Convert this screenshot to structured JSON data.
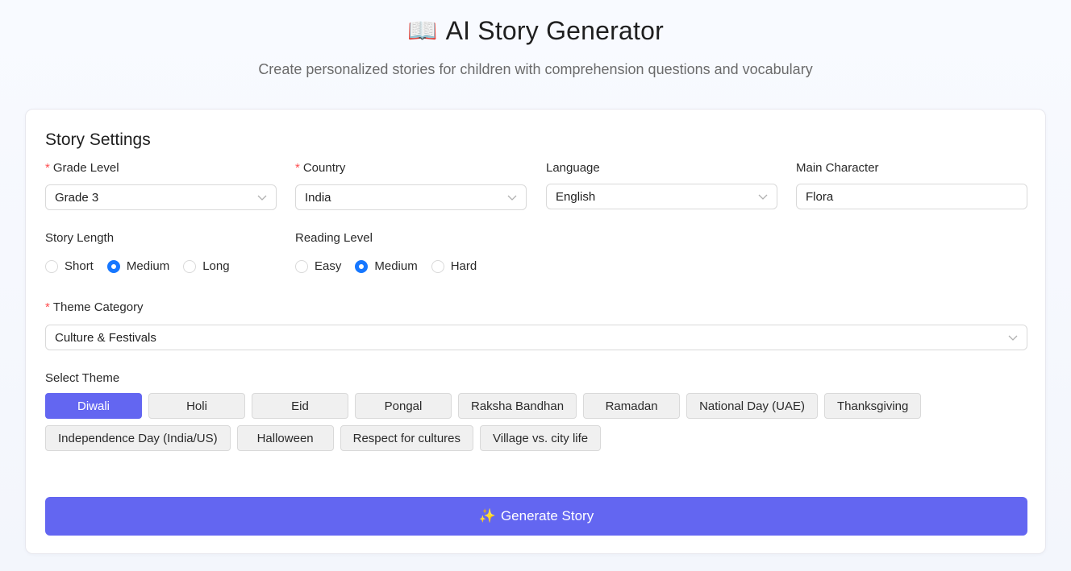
{
  "header": {
    "icon": "📖",
    "title": "AI Story Generator",
    "subtitle": "Create personalized stories for children with comprehension questions and vocabulary"
  },
  "settings": {
    "title": "Story Settings",
    "grade": {
      "label": "Grade Level",
      "value": "Grade 3",
      "required": true
    },
    "country": {
      "label": "Country",
      "value": "India",
      "required": true
    },
    "language": {
      "label": "Language",
      "value": "English"
    },
    "character": {
      "label": "Main Character",
      "value": "Flora"
    },
    "story_length": {
      "label": "Story Length",
      "options": [
        "Short",
        "Medium",
        "Long"
      ],
      "selected": "Medium"
    },
    "reading_level": {
      "label": "Reading Level",
      "options": [
        "Easy",
        "Medium",
        "Hard"
      ],
      "selected": "Medium"
    },
    "theme_category": {
      "label": "Theme Category",
      "value": "Culture & Festivals",
      "required": true
    },
    "select_theme": {
      "label": "Select Theme",
      "row1": [
        "Diwali",
        "Holi",
        "Eid",
        "Pongal",
        "Raksha Bandhan",
        "Ramadan",
        "National Day (UAE)",
        "Thanksgiving"
      ],
      "row2": [
        "Independence Day (India/US)",
        "Halloween",
        "Respect for cultures",
        "Village vs. city life"
      ],
      "selected": "Diwali"
    },
    "generate_button": {
      "icon": "✨",
      "label": "Generate Story"
    }
  },
  "colors": {
    "accent": "#6366f1",
    "radio": "#1677ff",
    "required": "#ff4d4f"
  }
}
